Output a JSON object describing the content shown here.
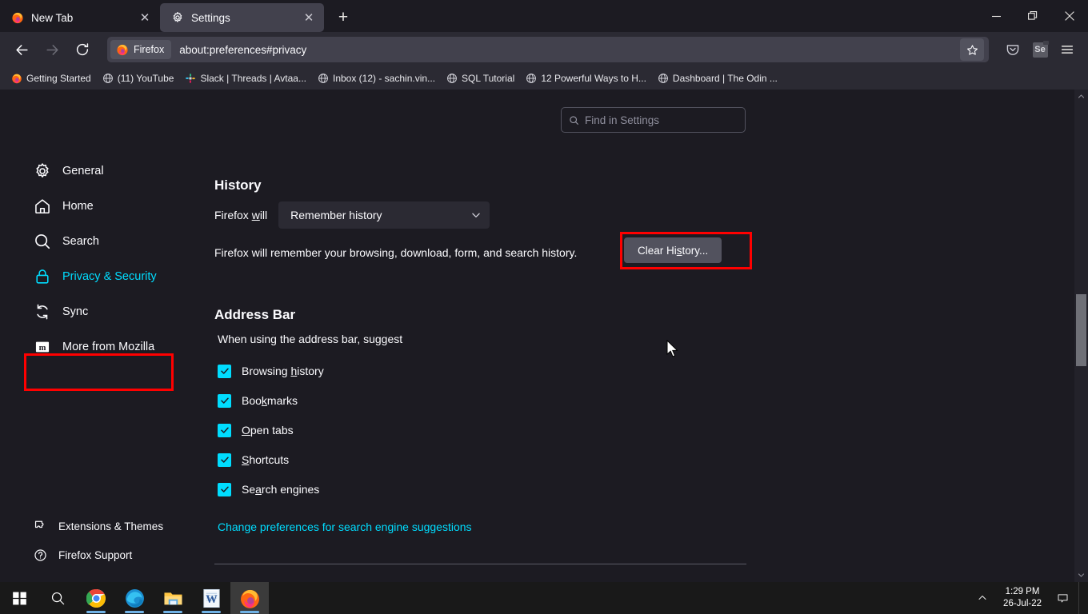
{
  "window": {
    "minimize_label": "Minimize",
    "restore_label": "Restore",
    "close_label": "Close"
  },
  "tabs": [
    {
      "title": "New Tab",
      "icon": "firefox-icon",
      "active": false
    },
    {
      "title": "Settings",
      "icon": "gear-icon",
      "active": true
    }
  ],
  "newtab_label": "+",
  "toolbar": {
    "back_label": "Back",
    "forward_label": "Forward",
    "reload_label": "Reload",
    "identity_label": "Firefox",
    "url": "about:preferences#privacy",
    "bookmark_label": "Bookmark this page",
    "pocket_label": "Save to Pocket",
    "extension_label": "Se",
    "menu_label": "Open application menu"
  },
  "bookmarks": [
    {
      "label": "Getting Started",
      "icon": "firefox-icon"
    },
    {
      "label": "(11) YouTube",
      "icon": "globe-icon"
    },
    {
      "label": "Slack | Threads | Avtaa...",
      "icon": "slack-icon"
    },
    {
      "label": "Inbox (12) - sachin.vin...",
      "icon": "globe-icon"
    },
    {
      "label": "SQL Tutorial",
      "icon": "globe-icon"
    },
    {
      "label": "12 Powerful Ways to H...",
      "icon": "globe-icon"
    },
    {
      "label": "Dashboard | The Odin ...",
      "icon": "globe-icon"
    }
  ],
  "search": {
    "placeholder": "Find in Settings",
    "icon": "search-icon"
  },
  "sidebar": {
    "items": [
      {
        "label": "General",
        "icon": "gear-icon",
        "selected": false
      },
      {
        "label": "Home",
        "icon": "home-icon",
        "selected": false
      },
      {
        "label": "Search",
        "icon": "search-icon",
        "selected": false
      },
      {
        "label": "Privacy & Security",
        "icon": "lock-icon",
        "selected": true
      },
      {
        "label": "Sync",
        "icon": "sync-icon",
        "selected": false
      },
      {
        "label": "More from Mozilla",
        "icon": "mozilla-icon",
        "selected": false
      }
    ],
    "bottom_items": [
      {
        "label": "Extensions & Themes",
        "icon": "extensions-icon"
      },
      {
        "label": "Firefox Support",
        "icon": "help-icon"
      }
    ]
  },
  "main": {
    "history": {
      "title": "History",
      "firefox_will_label_pre": "Firefox ",
      "firefox_will_label_key": "w",
      "firefox_will_label_post": "ill",
      "select_value": "Remember history",
      "select_chevron": "chevron-down-icon",
      "description": "Firefox will remember your browsing, download, form, and search history.",
      "clear_button_pre": "Clear Hi",
      "clear_button_key": "s",
      "clear_button_post": "tory..."
    },
    "address_bar": {
      "title": "Address Bar",
      "subtitle": "When using the address bar, suggest",
      "options": [
        {
          "pre": "Browsing ",
          "key": "h",
          "post": "istory",
          "checked": true
        },
        {
          "pre": "Boo",
          "key": "k",
          "post": "marks",
          "checked": true
        },
        {
          "pre": "",
          "key": "O",
          "post": "pen tabs",
          "checked": true
        },
        {
          "pre": "",
          "key": "S",
          "post": "hortcuts",
          "checked": true
        },
        {
          "pre": "Se",
          "key": "a",
          "post": "rch engines",
          "checked": true
        }
      ],
      "link": "Change preferences for search engine suggestions"
    }
  },
  "annotations": {
    "highlight_color": "#ff0000",
    "targets": [
      "Privacy & Security",
      "Clear History..."
    ]
  },
  "taskbar": {
    "items": [
      {
        "name": "start-button",
        "icon": "windows-icon",
        "running": false,
        "active": false
      },
      {
        "name": "search-button",
        "icon": "search-icon",
        "running": false,
        "active": false
      },
      {
        "name": "chrome-button",
        "icon": "chrome-icon",
        "running": true,
        "active": false
      },
      {
        "name": "edge-button",
        "icon": "edge-icon",
        "running": true,
        "active": false
      },
      {
        "name": "explorer-button",
        "icon": "folder-icon",
        "running": true,
        "active": false
      },
      {
        "name": "word-button",
        "icon": "word-icon",
        "running": true,
        "active": false
      },
      {
        "name": "firefox-button",
        "icon": "firefox-icon",
        "running": true,
        "active": true
      }
    ],
    "tray": {
      "chevron_label": "Show hidden icons",
      "time": "1:29 PM",
      "date": "26-Jul-22",
      "notification_label": "Notifications"
    }
  }
}
